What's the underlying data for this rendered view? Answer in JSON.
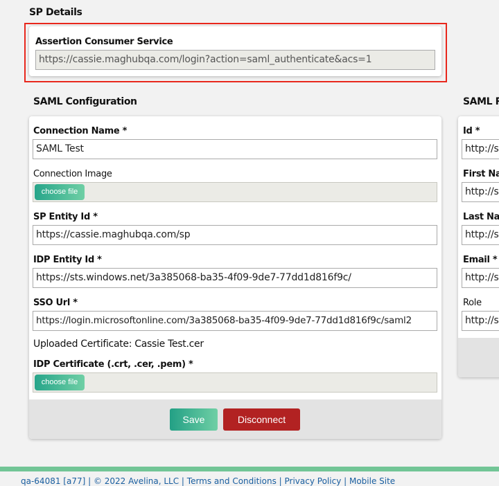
{
  "sp_details": {
    "title": "SP Details",
    "acs_label": "Assertion Consumer Service",
    "acs_value": "https://cassie.maghubqa.com/login?action=saml_authenticate&acs=1"
  },
  "saml_config": {
    "title": "SAML Configuration",
    "connection_name_label": "Connection Name *",
    "connection_name": "SAML Test",
    "connection_image_label": "Connection Image",
    "choose_file": "choose file",
    "sp_entity_label": "SP Entity Id *",
    "sp_entity": "https://cassie.maghubqa.com/sp",
    "idp_entity_label": "IDP Entity Id *",
    "idp_entity": "https://sts.windows.net/3a385068-ba35-4f09-9de7-77dd1d816f9c/",
    "sso_label": "SSO Url *",
    "sso": "https://login.microsoftonline.com/3a385068-ba35-4f09-9de7-77dd1d816f9c/saml2",
    "uploaded_cert": "Uploaded Certificate: Cassie Test.cer",
    "idp_cert_label": "IDP Certificate (.crt, .cer, .pem) *",
    "save": "Save",
    "disconnect": "Disconnect"
  },
  "saml_response": {
    "title": "SAML Re",
    "fields": [
      {
        "label": "Id *",
        "value": "http://s"
      },
      {
        "label": "First Nar",
        "value": "http://s"
      },
      {
        "label": "Last Nar",
        "value": "http://s"
      },
      {
        "label": "Email *",
        "value": "http://s"
      },
      {
        "label": "Role",
        "value": "http://s"
      }
    ]
  },
  "footer": {
    "text": "qa-64081 [a77] | © 2022 Avelina, LLC | Terms and Conditions | Privacy Policy | Mobile Site"
  },
  "colors": {
    "accent": "#72c596",
    "danger": "#b22222",
    "highlight": "#e8271c"
  }
}
